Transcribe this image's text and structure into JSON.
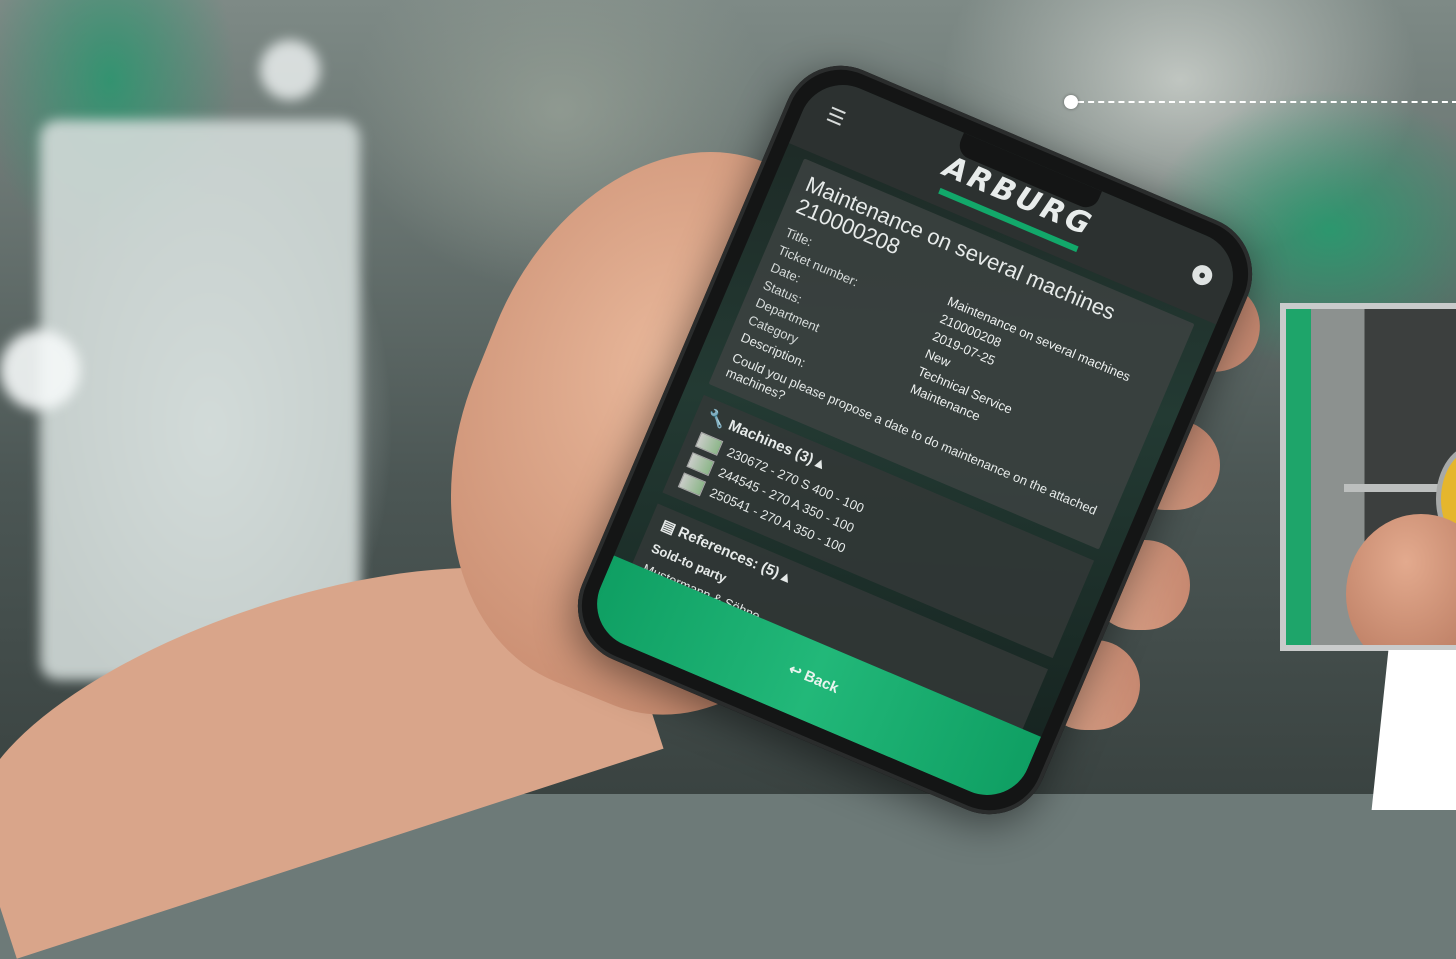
{
  "brand": {
    "logo_text": "ARBURG",
    "accent": "#12a86a"
  },
  "topbar": {
    "menu_icon": "hamburger-icon",
    "user_icon": "user-icon"
  },
  "ticket": {
    "heading": "Maintenance on several machines 210000208",
    "fields": [
      {
        "label": "Title:",
        "value": "Maintenance on several machines"
      },
      {
        "label": "Ticket number:",
        "value": "210000208"
      },
      {
        "label": "Date:",
        "value": "2019-07-25"
      },
      {
        "label": "Status:",
        "value": "New"
      },
      {
        "label": "Department",
        "value": "Technical Service"
      },
      {
        "label": "Category",
        "value": "Maintenance"
      }
    ],
    "description_label": "Description:",
    "description": "Could you please propose a date to do maintenance on the attached machines?"
  },
  "machines": {
    "title": "Machines (3)",
    "toggle": "▴",
    "items": [
      "230672 - 270 S 400 - 100",
      "244545 - 270 A 350 - 100",
      "250541 - 270 A 350 - 100"
    ]
  },
  "references": {
    "title": "References: (5)",
    "toggle": "▴",
    "label": "Sold-to party",
    "value": "Mustermann & Söhne"
  },
  "footer": {
    "back_label": "Back"
  }
}
